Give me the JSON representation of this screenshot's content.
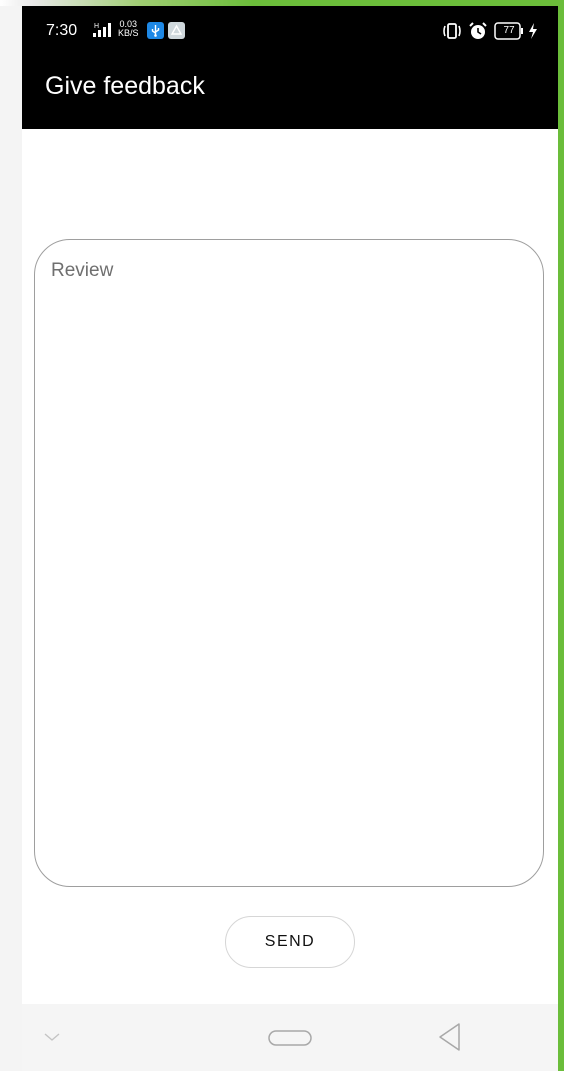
{
  "status_bar": {
    "time": "7:30",
    "net_speed_value": "0.03",
    "net_speed_unit": "KB/S",
    "battery_level": "77",
    "icons": [
      "signal-icon",
      "usb-icon",
      "drive-icon",
      "vibrate-icon",
      "alarm-icon",
      "battery-icon",
      "charging-icon"
    ]
  },
  "app_bar": {
    "title": "Give feedback"
  },
  "review": {
    "placeholder": "Review",
    "value": ""
  },
  "actions": {
    "send_label": "SEND"
  },
  "nav_bar": {
    "icons": [
      "chevron-down-icon",
      "home-icon",
      "back-icon"
    ]
  },
  "colors": {
    "header_bg": "#000000",
    "accent_green": "#6bbd3a",
    "field_border": "#9e9e9e",
    "nav_bg": "#f5f5f5"
  }
}
